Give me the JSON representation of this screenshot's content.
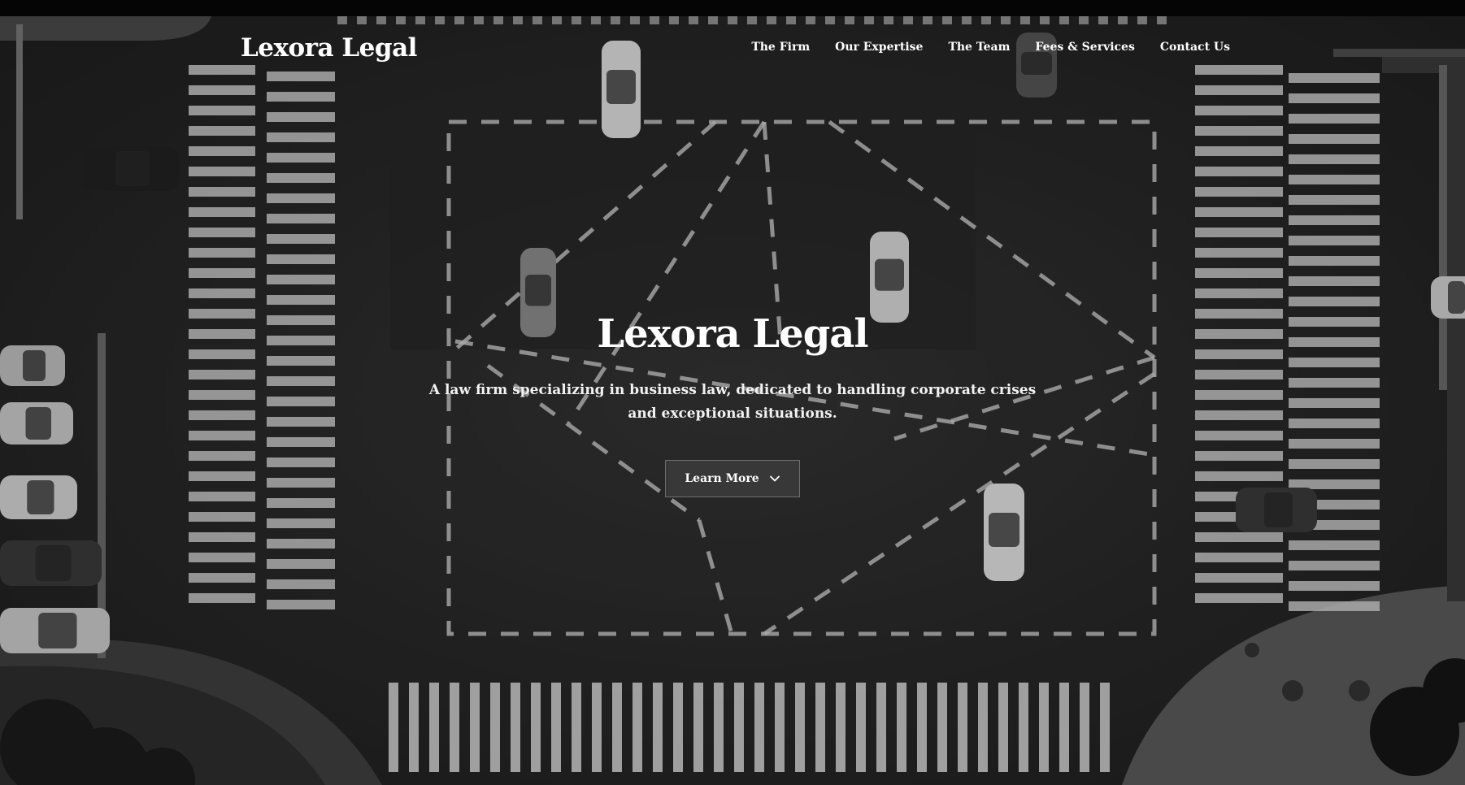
{
  "brand": {
    "logo_text": "Lexora Legal"
  },
  "nav": {
    "items": [
      {
        "label": "The Firm"
      },
      {
        "label": "Our Expertise"
      },
      {
        "label": "The Team"
      },
      {
        "label": "Fees & Services"
      },
      {
        "label": "Contact Us"
      }
    ]
  },
  "hero": {
    "title": "Lexora Legal",
    "subtitle": "A law firm specializing in business law, dedicated to handling corporate crises and exceptional situations.",
    "cta_label": "Learn More",
    "cta_icon": "chevron-down-icon",
    "background": "aerial-intersection-grayscale-photo"
  },
  "colors": {
    "text": "#ffffff",
    "background": "#2a2a2a",
    "button_bg": "#3c3c3c",
    "button_border": "#6f6f6f"
  }
}
